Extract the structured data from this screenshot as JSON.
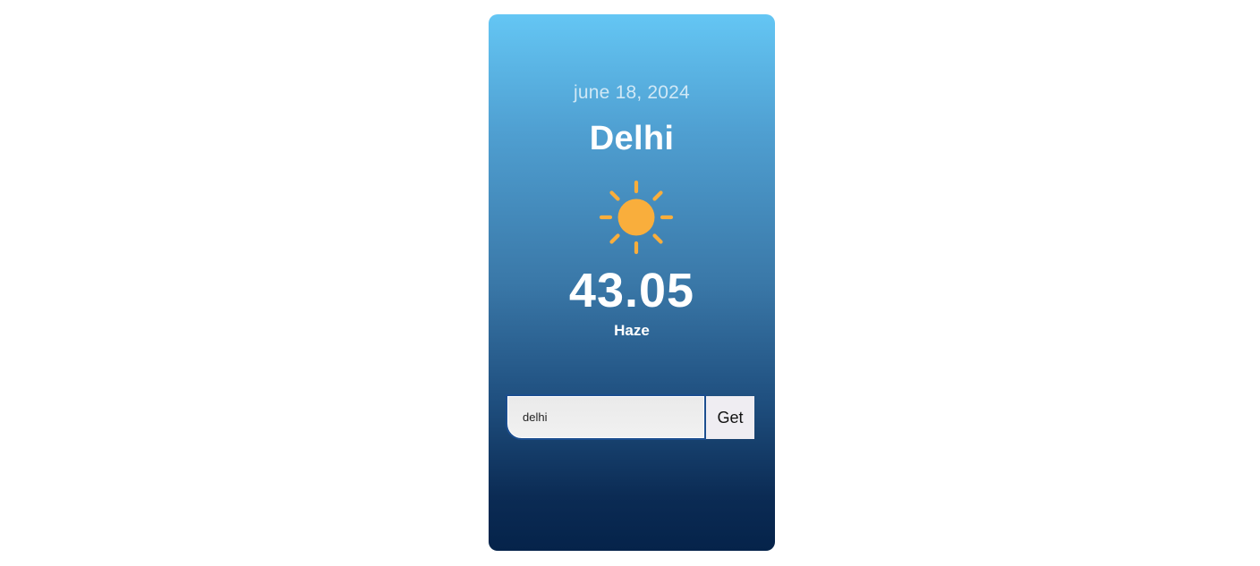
{
  "weather": {
    "date": "june 18, 2024",
    "city": "Delhi",
    "icon": "sun-icon",
    "temperature": "43.05",
    "condition": "Haze"
  },
  "search": {
    "value": "delhi",
    "button_label": "Get"
  },
  "colors": {
    "sun": "#f9ae3c",
    "gradient_top": "#64c6f4",
    "gradient_bottom": "#05234a"
  }
}
